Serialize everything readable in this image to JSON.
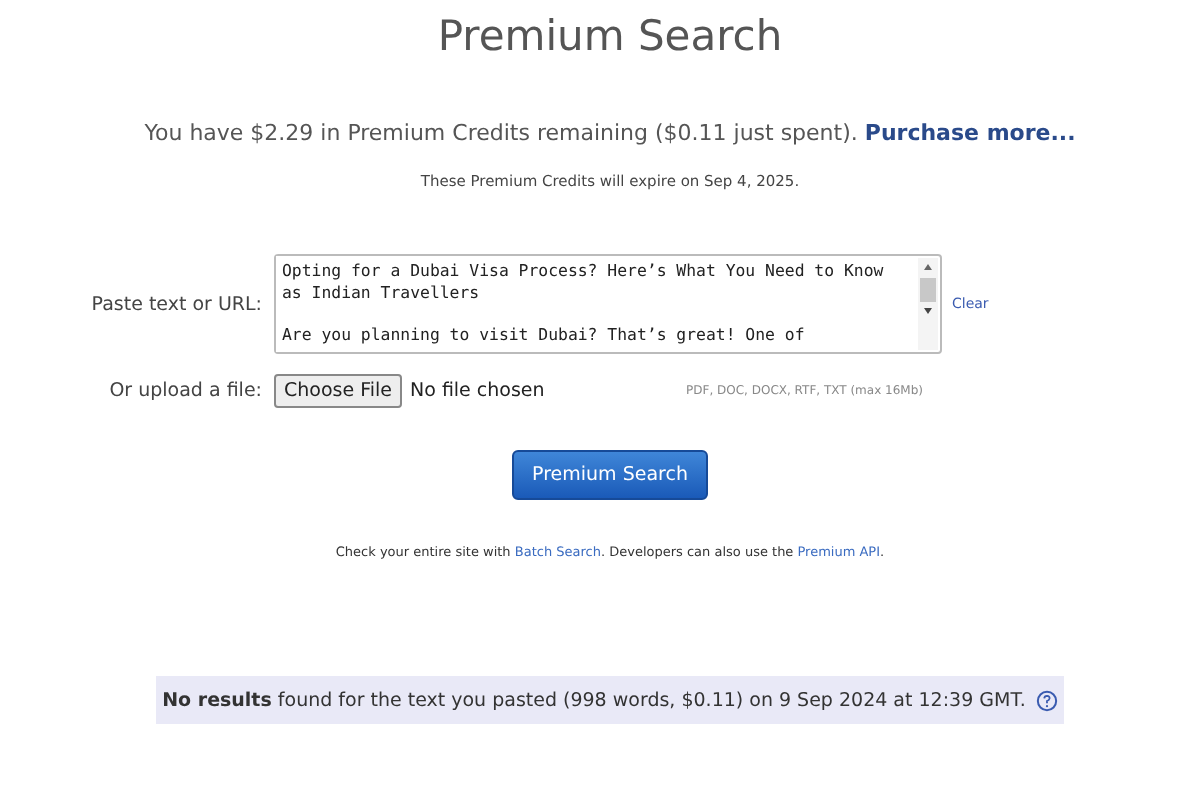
{
  "title": "Premium Search",
  "credits": {
    "text": "You have $2.29 in Premium Credits remaining ($0.11 just spent).",
    "link": "Purchase more..."
  },
  "expiry": "These Premium Credits will expire on Sep 4, 2025.",
  "paste": {
    "label": "Paste text or URL:",
    "value": "Opting for a Dubai Visa Process? Here’s What You Need to Know as Indian Travellers\n\nAre you planning to visit Dubai? That’s great! One of",
    "clear": "Clear"
  },
  "upload": {
    "label": "Or upload a file:",
    "button": "Choose File",
    "status": "No file chosen",
    "formats": "PDF, DOC, DOCX, RTF, TXT (max 16Mb)"
  },
  "search_button": "Premium Search",
  "footer": {
    "parts": [
      {
        "kind": "text",
        "text": "Check your entire site with "
      },
      {
        "kind": "link",
        "text": "Batch Search"
      },
      {
        "kind": "text",
        "text": ". Developers can also use the "
      },
      {
        "kind": "link",
        "text": "Premium API"
      },
      {
        "kind": "text",
        "text": "."
      }
    ]
  },
  "result": "**No results** found for the text you pasted (998 words, $0.11) on 9 Sep 2024 at 12:39 GMT."
}
